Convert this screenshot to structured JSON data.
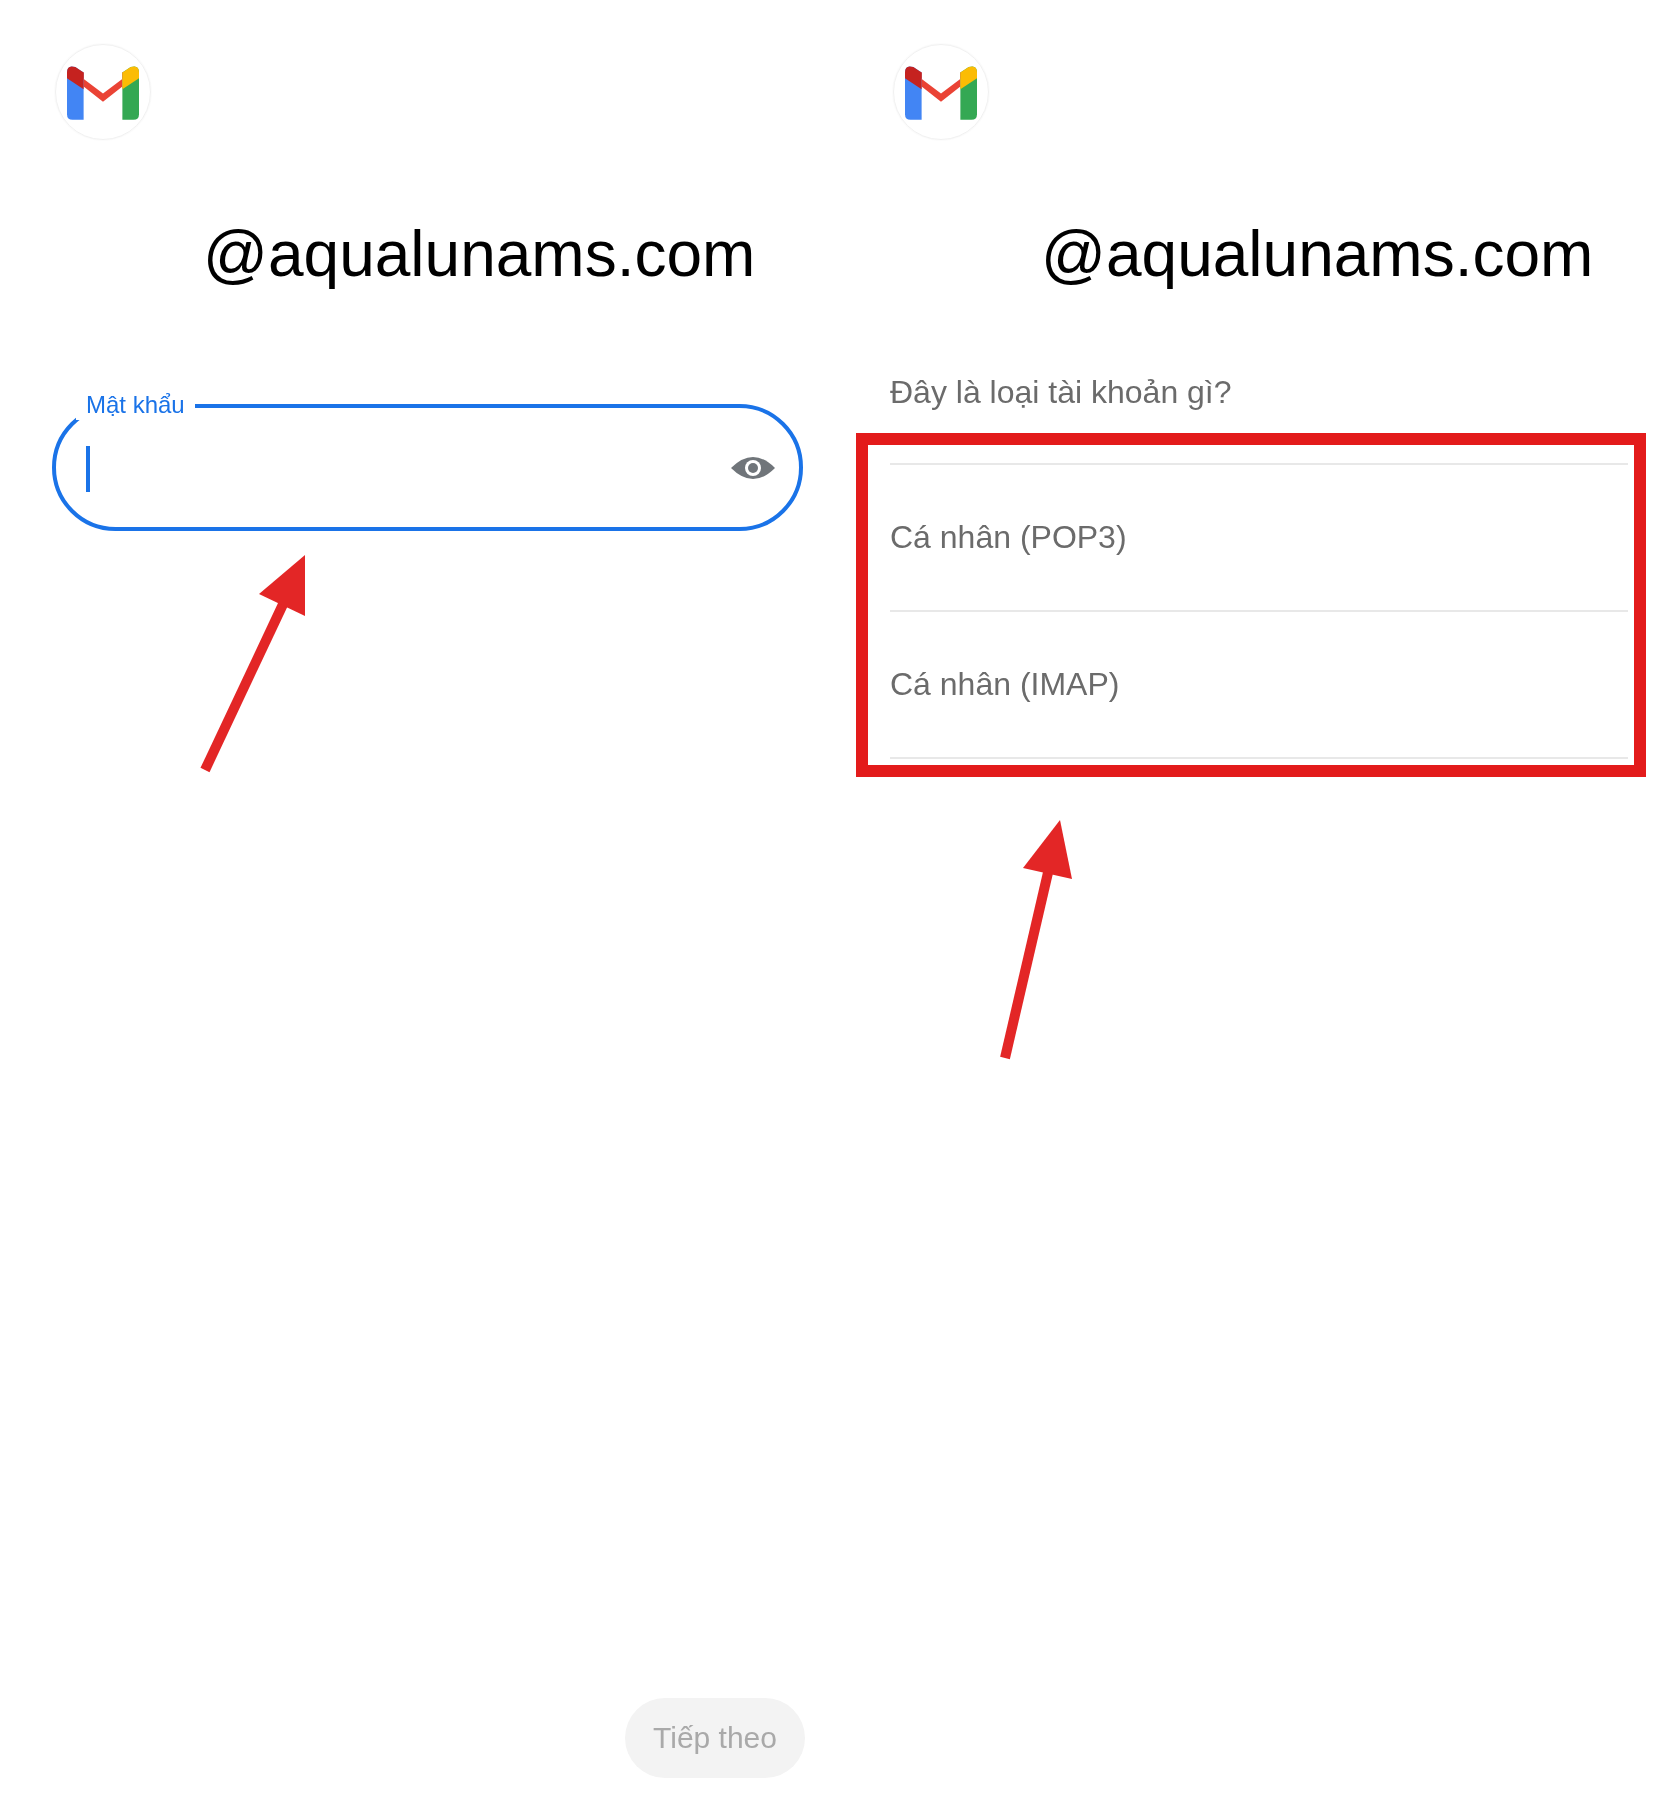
{
  "panels": [
    {
      "kind": "password",
      "account": "@aqualunams.com",
      "field": {
        "label": "Mật khẩu",
        "focused": true
      },
      "next_button": {
        "label": "Tiếp theo",
        "disabled": true
      }
    },
    {
      "kind": "account_type",
      "account": "@aqualunams.com",
      "question": "Đây là loại tài khoản gì?",
      "options": [
        {
          "label": "Cá nhân (POP3)"
        },
        {
          "label": "Cá nhân (IMAP)"
        }
      ]
    }
  ]
}
